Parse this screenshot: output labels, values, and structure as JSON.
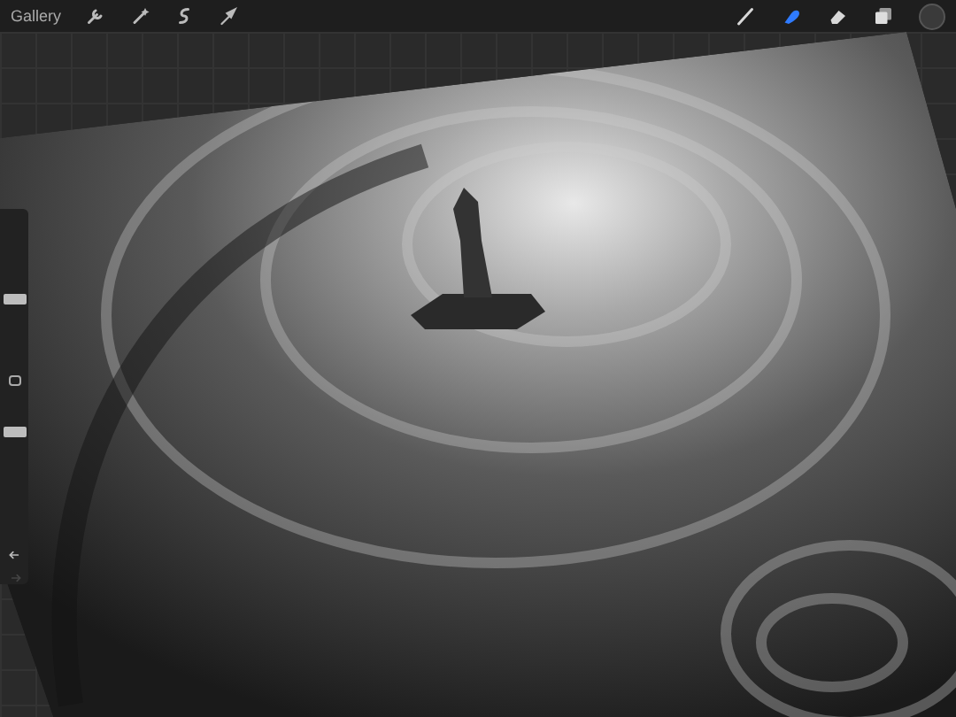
{
  "toolbar": {
    "gallery": "Gallery",
    "actions": [
      {
        "kind": "wrench"
      },
      {
        "kind": "wand"
      },
      {
        "kind": "selection"
      },
      {
        "kind": "transform"
      }
    ],
    "tools": [
      {
        "kind": "brush",
        "selected": false
      },
      {
        "kind": "smudge",
        "selected": true
      },
      {
        "kind": "eraser",
        "selected": false
      }
    ]
  },
  "sidebar": {
    "size_slider": {
      "level": 0.5
    },
    "opacity_slider": {
      "level": 0.9
    },
    "undo": {
      "disabled": false
    },
    "redo": {
      "disabled": true
    }
  }
}
